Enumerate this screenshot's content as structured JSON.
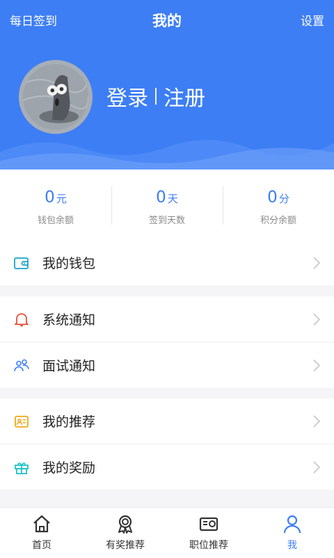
{
  "header": {
    "left_label": "每日签到",
    "title": "我的",
    "right_label": "设置",
    "login": "登录",
    "register": "注册",
    "bg_color": "#3d7ef5"
  },
  "stats": [
    {
      "value": "0",
      "unit": "元",
      "label": "钱包余额"
    },
    {
      "value": "0",
      "unit": "天",
      "label": "签到天数"
    },
    {
      "value": "0",
      "unit": "分",
      "label": "积分余额"
    }
  ],
  "menu": [
    {
      "label": "我的钱包",
      "icon": "wallet-icon"
    },
    {
      "label": "系统通知",
      "icon": "bell-icon"
    },
    {
      "label": "面试通知",
      "icon": "people-icon"
    },
    {
      "label": "我的推荐",
      "icon": "id-card-icon"
    },
    {
      "label": "我的奖励",
      "icon": "gift-icon"
    }
  ],
  "nav": [
    {
      "label": "首页",
      "icon": "home-icon"
    },
    {
      "label": "有奖推荐",
      "icon": "award-icon"
    },
    {
      "label": "职位推荐",
      "icon": "job-icon"
    },
    {
      "label": "我",
      "icon": "person-icon",
      "active": true
    }
  ]
}
